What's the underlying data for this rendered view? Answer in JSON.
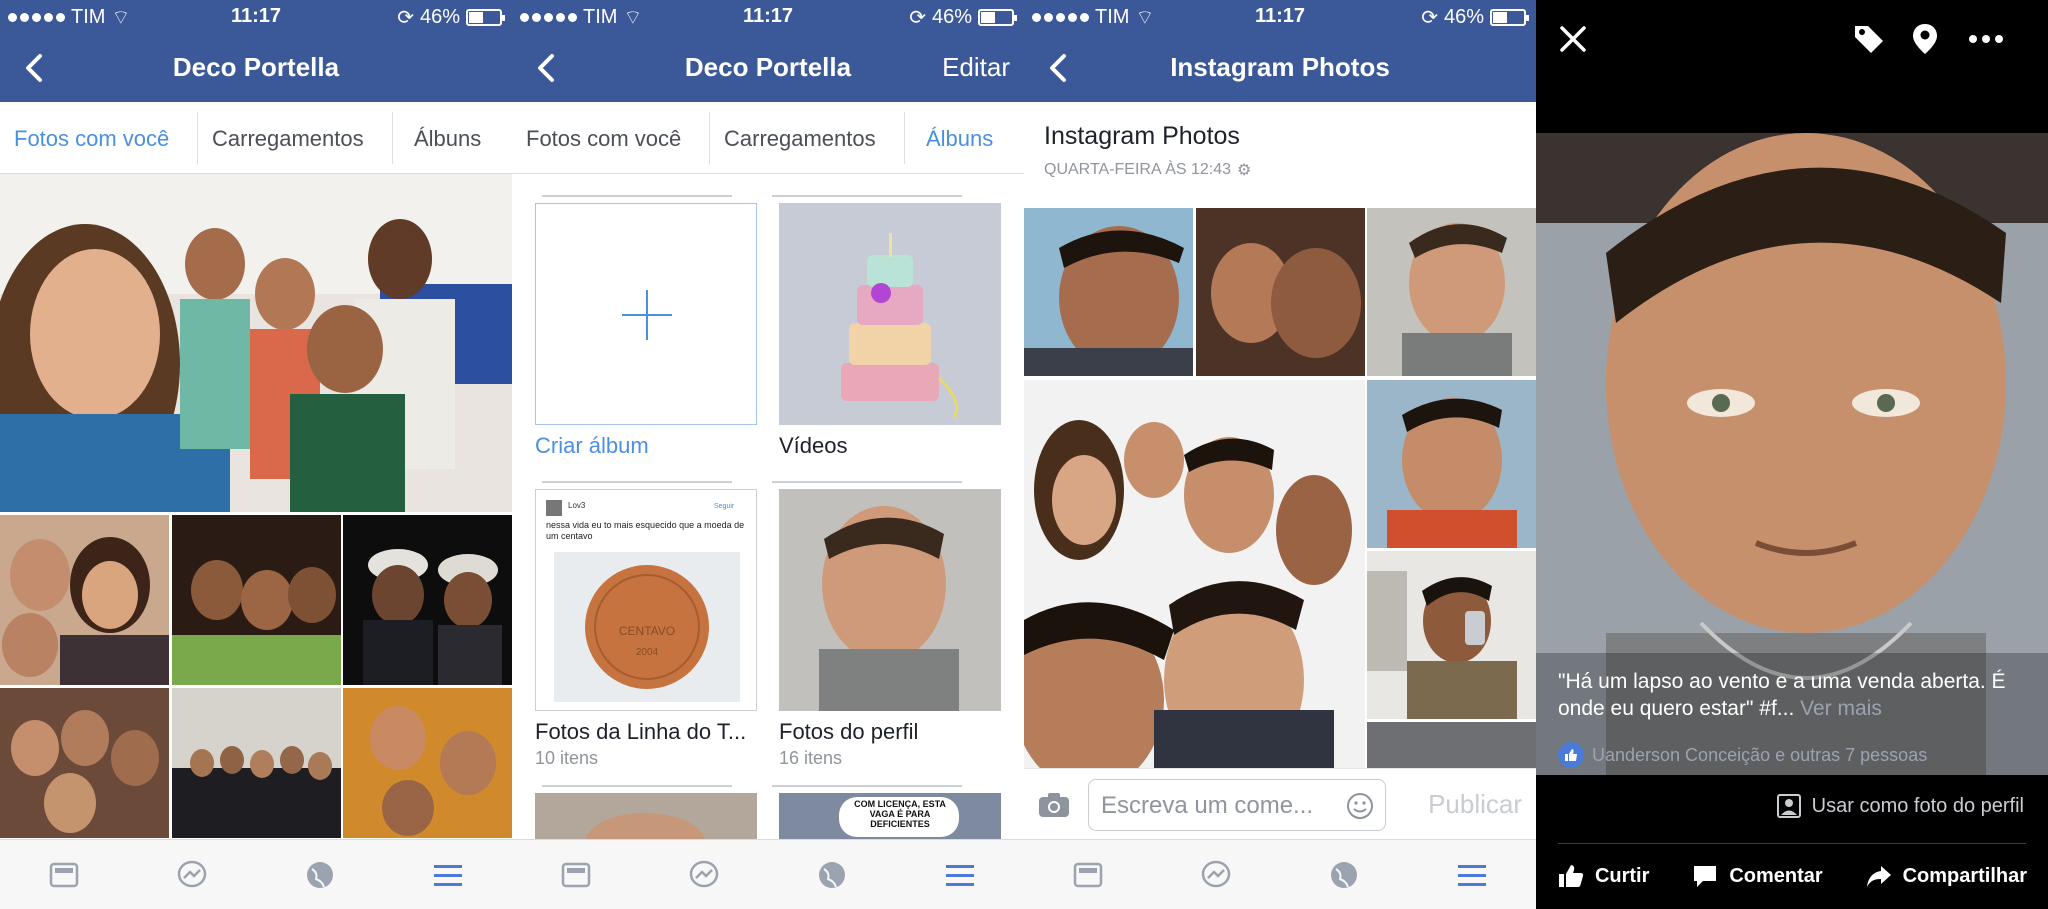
{
  "status": {
    "carrier": "TIM",
    "time": "11:17",
    "battery": "46%"
  },
  "panel1": {
    "title": "Deco Portella",
    "tabs": [
      "Fotos com você",
      "Carregamentos",
      "Álbuns"
    ],
    "active_tab": "Fotos com você"
  },
  "panel2": {
    "title": "Deco Portella",
    "edit_label": "Editar",
    "tabs": [
      "Fotos com você",
      "Carregamentos",
      "Álbuns"
    ],
    "active_tab": "Álbuns",
    "albums": [
      {
        "name": "Criar álbum",
        "count": ""
      },
      {
        "name": "Vídeos",
        "count": ""
      },
      {
        "name": "Fotos da Linha do T...",
        "count": "10 itens"
      },
      {
        "name": "Fotos do perfil",
        "count": "16 itens"
      }
    ],
    "post_thumb": {
      "author": "Lov3",
      "text": "nessa vida eu to mais esquecido que a moeda de um centavo",
      "coin_text": "CENTAVO",
      "coin_year": "2004",
      "follow": "Seguir"
    },
    "sign_text": "COM LICENÇA, ESTA VAGA É PARA DEFICIENTES"
  },
  "panel3": {
    "title": "Instagram Photos",
    "album_title": "Instagram Photos",
    "album_date": "QUARTA-FEIRA ÀS 12:43",
    "comment_placeholder": "Escreva um come...",
    "publish_label": "Publicar"
  },
  "panel4": {
    "caption": "\"Há um lapso ao vento e a uma venda aberta. É onde eu quero estar\" #f...",
    "see_more": "Ver mais",
    "likes": "Uanderson Conceição e outras 7 pessoas",
    "profile_use": "Usar como foto do perfil",
    "actions": {
      "like": "Curtir",
      "comment": "Comentar",
      "share": "Compartilhar"
    }
  },
  "colors": {
    "brand": "#3b5998",
    "active_tab": "#4a90e2",
    "tabbar_icon": "#4a7bd8"
  }
}
